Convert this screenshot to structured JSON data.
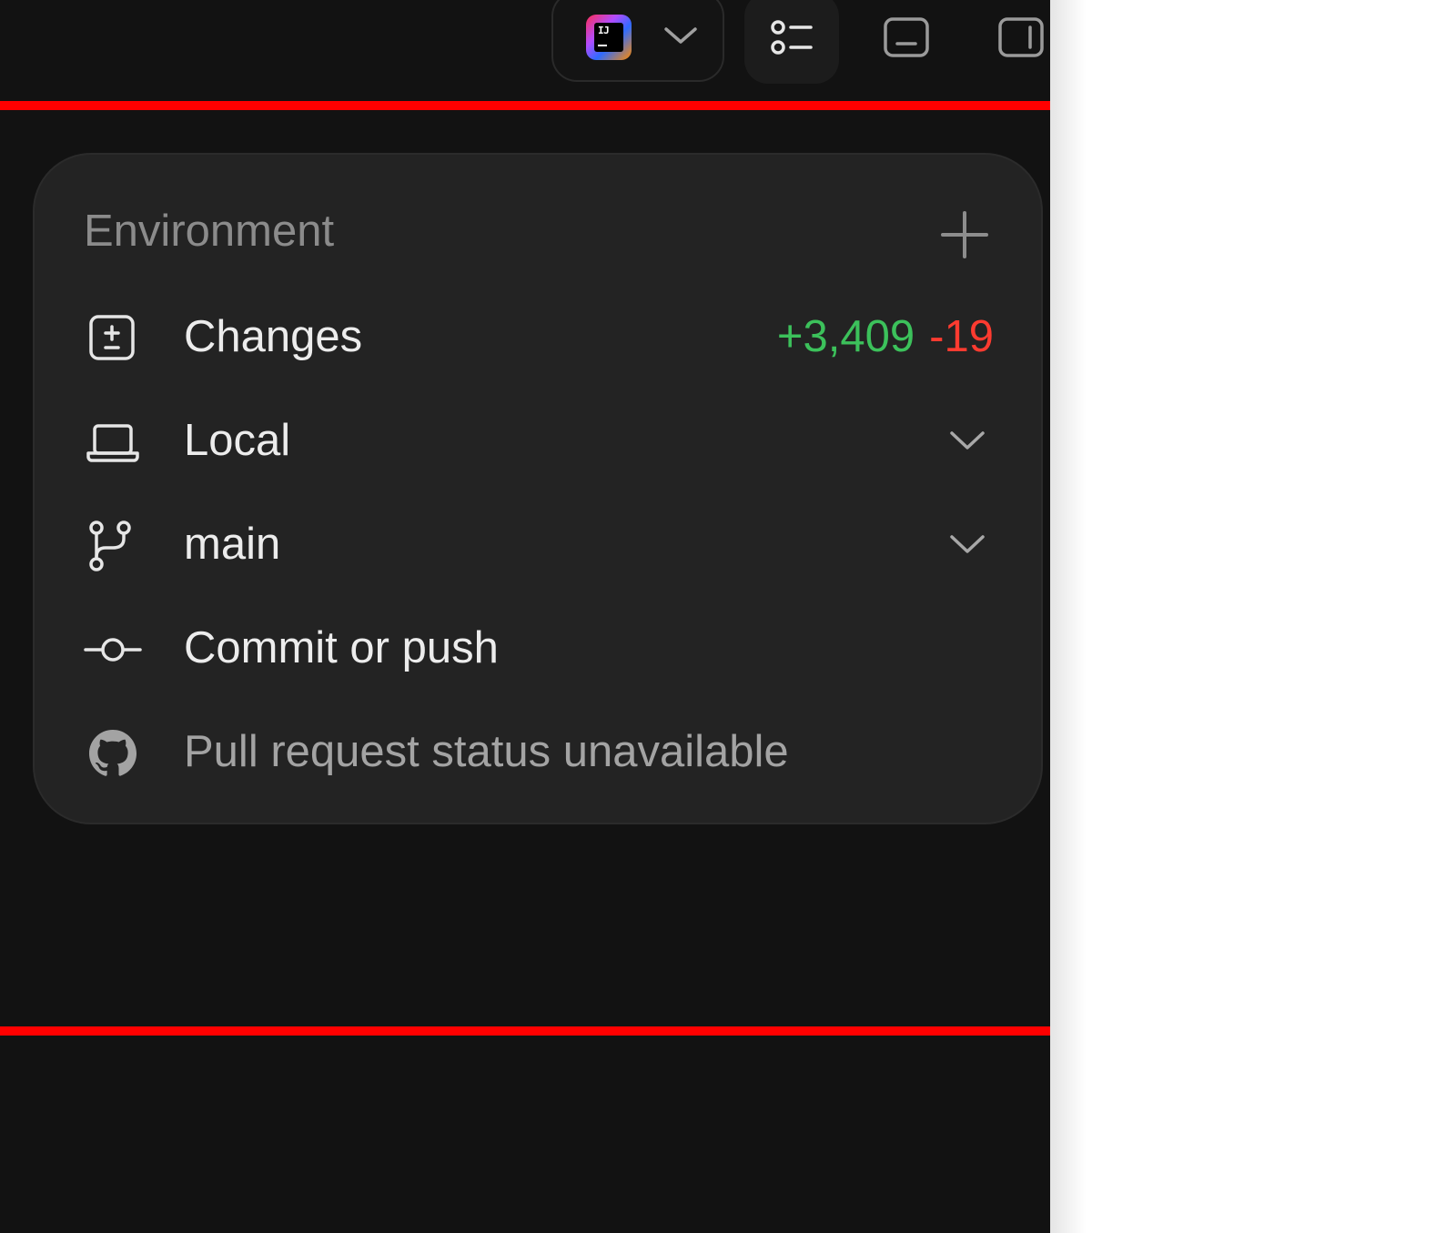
{
  "colors": {
    "background": "#121212",
    "panel": "#232323",
    "accent_red": "#ff0000",
    "additions": "#3cc15b",
    "deletions": "#ff3b30"
  },
  "toolbar": {
    "ide_switcher": {
      "icon": "intellij-idea-icon",
      "logo_text": "IJ",
      "dropdown_icon": "chevron-down-icon"
    },
    "buttons": [
      {
        "icon": "task-list-icon",
        "active": true
      },
      {
        "icon": "bottom-panel-icon",
        "active": false
      },
      {
        "icon": "right-sidebar-icon",
        "active": false
      }
    ]
  },
  "environment": {
    "title": "Environment",
    "add_icon": "plus-icon",
    "items": {
      "changes": {
        "label": "Changes",
        "icon": "diff-icon",
        "additions": "+3,409",
        "deletions": "-19"
      },
      "local": {
        "label": "Local",
        "icon": "laptop-icon",
        "dropdown": true
      },
      "branch": {
        "label": "main",
        "icon": "git-branch-icon",
        "dropdown": true
      },
      "commit": {
        "label": "Commit or push",
        "icon": "git-commit-icon"
      },
      "pull_request": {
        "label": "Pull request status unavailable",
        "icon": "github-icon"
      }
    }
  }
}
